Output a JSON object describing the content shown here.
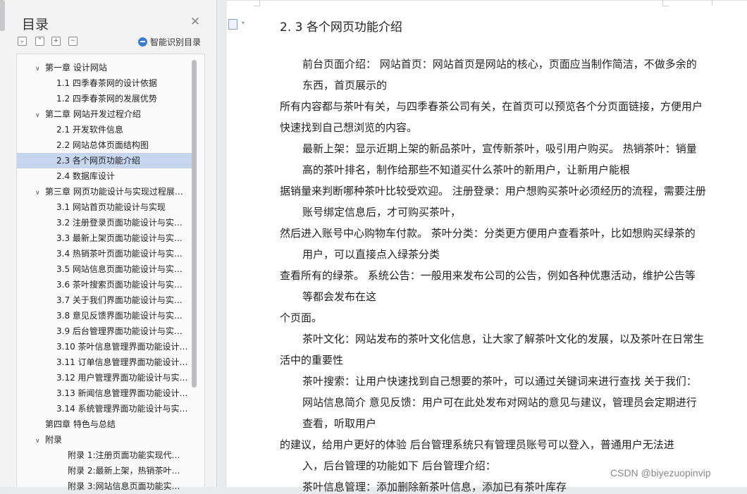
{
  "toc": {
    "title": "目录",
    "close_icon": "close-icon",
    "toolbar_buttons": [
      "collapse-all",
      "expand-all",
      "add",
      "remove"
    ],
    "smart_toc_label": "智能识别目录",
    "items": [
      {
        "label": "第一章 设计网站",
        "level": 1,
        "expanded": true
      },
      {
        "label": "1.1 四季春茶网的设计依据",
        "level": 2
      },
      {
        "label": "1.2 四季春茶网的发展优势",
        "level": 2
      },
      {
        "label": "第二章 网站开发过程介绍",
        "level": 1,
        "expanded": true
      },
      {
        "label": "2.1 开发软件信息",
        "level": 2
      },
      {
        "label": "2.2 网站总体页面结构图",
        "level": 2
      },
      {
        "label": "2.3 各个网页功能介绍",
        "level": 2,
        "selected": true
      },
      {
        "label": "2.4 数据库设计",
        "level": 2
      },
      {
        "label": "第三章 网页功能设计与实现过程展…",
        "level": 1,
        "expanded": true
      },
      {
        "label": "3.1 网站首页功能设计与实现",
        "level": 2
      },
      {
        "label": "3.2 注册登录页面功能设计与实…",
        "level": 2
      },
      {
        "label": "3.3 最新上架页面功能设计与实…",
        "level": 2
      },
      {
        "label": "3.4 热销茶叶页面功能设计与实…",
        "level": 2
      },
      {
        "label": "3.5 网站信息页面功能设计与实…",
        "level": 2
      },
      {
        "label": "3.6 茶叶搜索页面功能设计与实…",
        "level": 2
      },
      {
        "label": "3.7 关于我们界面功能设计与实…",
        "level": 2
      },
      {
        "label": "3.8 意见反馈界面功能设计与实…",
        "level": 2
      },
      {
        "label": "3.9 后台管理界面功能设计与实…",
        "level": 2
      },
      {
        "label": "3.10 茶叶信息管理界面功能设计…",
        "level": 2
      },
      {
        "label": "3.11 订单信息管理界面功能设计…",
        "level": 2
      },
      {
        "label": "3.12 用户管理界面功能设计与实…",
        "level": 2
      },
      {
        "label": "3.13 新闻信息管理界面功能设计…",
        "level": 2
      },
      {
        "label": "3.14 系统管理界面功能设计与实…",
        "level": 2
      },
      {
        "label": "第四章 特色与总结",
        "level": 1,
        "expanded": null
      },
      {
        "label": "附录",
        "level": 1,
        "expanded": true
      },
      {
        "label": "附录 1:注册页面功能实现代…",
        "level": 3
      },
      {
        "label": "附录 2:最新上架，热销茶叶…",
        "level": 3
      },
      {
        "label": "附录 3:网站信息页面功能实…",
        "level": 3
      }
    ]
  },
  "document": {
    "heading": "2. 3 各个网页功能介绍",
    "lines": [
      "前台页面介绍：  网站首页：网站首页是网站的核心，页面应当制作简洁，不做多余的",
      "东西，首页展示的",
      "所有内容都与茶叶有关，与四季春茶公司有关，在首页可以预览各个分页面链接，方便用户",
      "快速找到自己想浏览的内容。",
      "最新上架：显示近期上架的新品茶叶，宣传新茶叶，吸引用户购买。  热销茶叶：销量",
      "高的茶叶排名，制作给那些不知道买什么茶叶的新用户，让新用户能根",
      "据销量来判断哪种茶叶比较受欢迎。  注册登录：用户想购买茶叶必须经历的流程，需要注册",
      "账号绑定信息后，才可购买茶叶，",
      "然后进入账号中心购物车付款。  茶叶分类：分类更方便用户查看茶叶，比如想购买绿茶的",
      "用户，可以直接点入绿茶分类",
      "查看所有的绿茶。  系统公告：一般用来发布公司的公告，例如各种优惠活动，维护公告等",
      "等都会发布在这",
      "个页面。",
      "茶叶文化：网站发布的茶叶文化信息，让大家了解茶叶文化的发展，以及茶叶在日常生",
      "活中的重要性",
      "茶叶搜索：让用户快速找到自己想要的茶叶，可以通过关键词来进行查找  关于我们：",
      "网站信息简介  意见反馈：用户可在此处发布对网站的意见与建议，管理员会定期进行",
      "查看，听取用户",
      "的建议，给用户更好的体验  后台管理系统只有管理员账号可以登入，普通用户无法进",
      "入，后台管理的功能如下  后台管理介绍：",
      "茶叶信息管理：添加删除新茶叶信息，添加已有茶叶库存"
    ]
  },
  "watermark": "CSDN @biyezuopinvip"
}
